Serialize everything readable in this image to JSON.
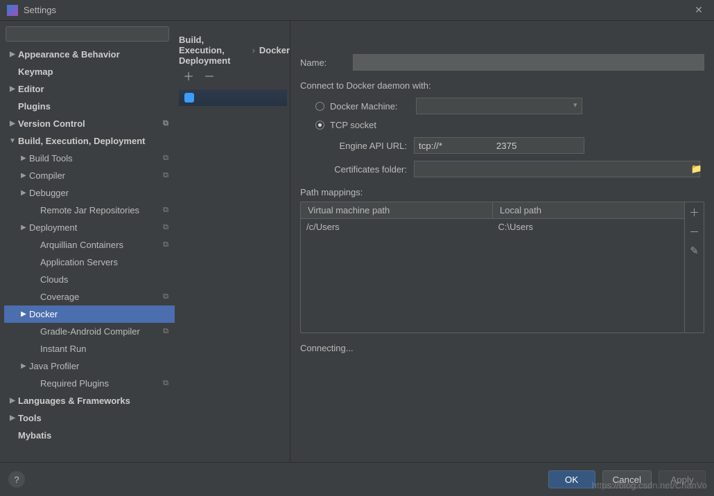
{
  "window": {
    "title": "Settings"
  },
  "search": {
    "placeholder": ""
  },
  "sidebar": {
    "items": [
      {
        "label": "Appearance & Behavior",
        "bold": true,
        "arrow": "right"
      },
      {
        "label": "Keymap",
        "bold": true
      },
      {
        "label": "Editor",
        "bold": true,
        "arrow": "right"
      },
      {
        "label": "Plugins",
        "bold": true
      },
      {
        "label": "Version Control",
        "bold": true,
        "arrow": "right",
        "badge": true
      },
      {
        "label": "Build, Execution, Deployment",
        "bold": true,
        "arrow": "down"
      },
      {
        "label": "Build Tools",
        "indent": 1,
        "arrow": "right",
        "badge": true
      },
      {
        "label": "Compiler",
        "indent": 1,
        "arrow": "right",
        "badge": true
      },
      {
        "label": "Debugger",
        "indent": 1,
        "arrow": "right"
      },
      {
        "label": "Remote Jar Repositories",
        "indent": 2,
        "badge": true
      },
      {
        "label": "Deployment",
        "indent": 1,
        "arrow": "right",
        "badge": true
      },
      {
        "label": "Arquillian Containers",
        "indent": 2,
        "badge": true
      },
      {
        "label": "Application Servers",
        "indent": 2
      },
      {
        "label": "Clouds",
        "indent": 2
      },
      {
        "label": "Coverage",
        "indent": 2,
        "badge": true
      },
      {
        "label": "Docker",
        "indent": 1,
        "arrow": "right",
        "selected": true
      },
      {
        "label": "Gradle-Android Compiler",
        "indent": 2,
        "badge": true
      },
      {
        "label": "Instant Run",
        "indent": 2
      },
      {
        "label": "Java Profiler",
        "indent": 1,
        "arrow": "right"
      },
      {
        "label": "Required Plugins",
        "indent": 2,
        "badge": true
      },
      {
        "label": "Languages & Frameworks",
        "bold": true,
        "arrow": "right"
      },
      {
        "label": "Tools",
        "bold": true,
        "arrow": "right"
      },
      {
        "label": "Mybatis",
        "bold": true
      }
    ]
  },
  "breadcrumb": {
    "a": "Build, Execution, Deployment",
    "b": "Docker"
  },
  "midlist": {
    "item0": ""
  },
  "form": {
    "name_label": "Name:",
    "name_value": "",
    "connect_label": "Connect to Docker daemon with:",
    "radio_machine": "Docker Machine:",
    "radio_tcp": "TCP socket",
    "engine_label": "Engine API URL:",
    "engine_value": "tcp://*                     2375",
    "cert_label": "Certificates folder:",
    "cert_value": "",
    "path_label": "Path mappings:",
    "col_vm": "Virtual machine path",
    "col_local": "Local path",
    "row0_vm": "/c/Users",
    "row0_local": "C:\\Users",
    "status": "Connecting..."
  },
  "footer": {
    "ok": "OK",
    "cancel": "Cancel",
    "apply": "Apply"
  },
  "watermark": "https://blog.csdn.net/ChanVo"
}
